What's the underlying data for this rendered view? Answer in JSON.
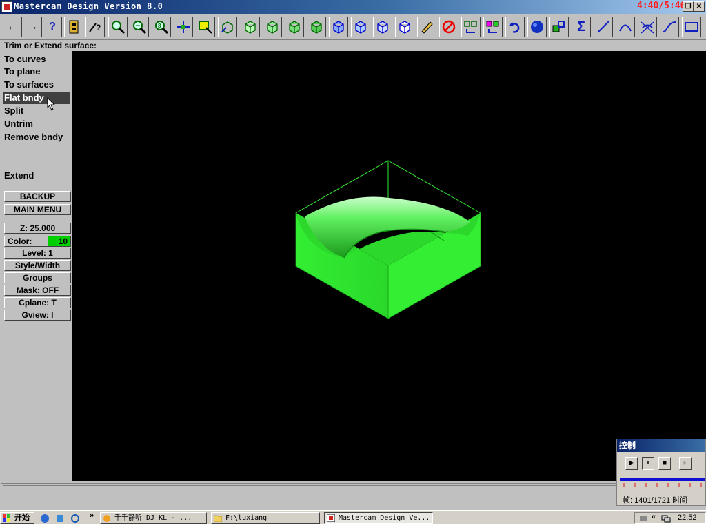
{
  "window": {
    "title": "Mastercam Design Version 8.0",
    "timer": "4:40/5:46"
  },
  "toolbar": {
    "back": "←",
    "forward": "→",
    "help": "?"
  },
  "prompt": "Trim or Extend surface:",
  "menu": {
    "items": [
      "To curves",
      "To plane",
      "To surfaces",
      "Flat bndy",
      "Split",
      "Untrim",
      "Remove bndy",
      "Extend"
    ],
    "backup": "BACKUP",
    "main_menu": "MAIN MENU",
    "z": "Z:  25.000",
    "color_label": "Color:",
    "color_value": "10",
    "level": "Level:  1",
    "style_width": "Style/Width",
    "groups": "Groups",
    "mask": "Mask:  OFF",
    "cplane": "Cplane:  T",
    "gview": "Gview:  I"
  },
  "colors": {
    "geometry": "#33ee33",
    "viewport_bg": "#000000"
  },
  "control_panel": {
    "title": "控制",
    "frame": "帧:  1401/1721  时间"
  },
  "taskbar": {
    "start": "开始",
    "tasks": [
      "千千静听   DJ KL - ...",
      "F:\\luxiang",
      "Mastercam Design Ve..."
    ],
    "clock": "22:52"
  }
}
